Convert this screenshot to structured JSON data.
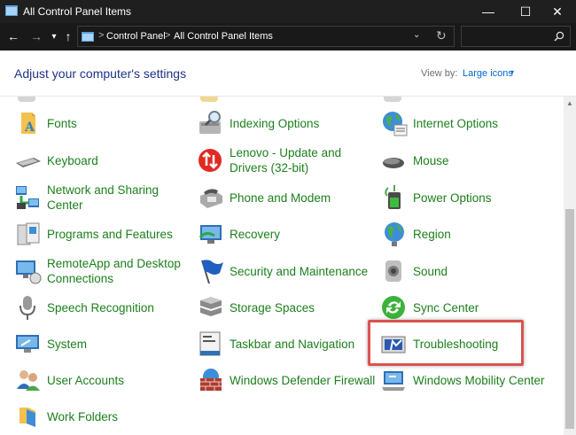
{
  "window": {
    "title": "All Control Panel Items",
    "minimize": "—",
    "maximize": "☐",
    "close": "✕"
  },
  "nav": {
    "back": "←",
    "forward": "→",
    "recent": "▾",
    "up": "↑"
  },
  "address": {
    "crumbs": [
      "Control Panel",
      "All Control Panel Items"
    ],
    "separator": ">",
    "dropdown": "⌄",
    "refresh": "↻"
  },
  "search": {
    "value": "",
    "placeholder": ""
  },
  "header": {
    "heading": "Adjust your computer's settings",
    "view_by_label": "View by:",
    "view_by_value": "Large icons",
    "caret": "▾"
  },
  "items": [
    {
      "label": "Fonts",
      "icon": "fonts-icon"
    },
    {
      "label": "Indexing Options",
      "icon": "indexing-icon"
    },
    {
      "label": "Internet Options",
      "icon": "globe-icon"
    },
    {
      "label": "Keyboard",
      "icon": "keyboard-icon"
    },
    {
      "label": "Lenovo - Update and Drivers (32-bit)",
      "icon": "lenovo-update-icon"
    },
    {
      "label": "Mouse",
      "icon": "mouse-icon"
    },
    {
      "label": "Network and Sharing Center",
      "icon": "network-icon"
    },
    {
      "label": "Phone and Modem",
      "icon": "phone-icon"
    },
    {
      "label": "Power Options",
      "icon": "power-icon"
    },
    {
      "label": "Programs and Features",
      "icon": "programs-icon"
    },
    {
      "label": "Recovery",
      "icon": "recovery-icon"
    },
    {
      "label": "Region",
      "icon": "region-globe-icon"
    },
    {
      "label": "RemoteApp and Desktop Connections",
      "icon": "remoteapp-icon"
    },
    {
      "label": "Security and Maintenance",
      "icon": "flag-icon"
    },
    {
      "label": "Sound",
      "icon": "speaker-icon"
    },
    {
      "label": "Speech Recognition",
      "icon": "microphone-icon"
    },
    {
      "label": "Storage Spaces",
      "icon": "storage-icon"
    },
    {
      "label": "Sync Center",
      "icon": "sync-icon"
    },
    {
      "label": "System",
      "icon": "system-icon"
    },
    {
      "label": "Taskbar and Navigation",
      "icon": "taskbar-icon"
    },
    {
      "label": "Troubleshooting",
      "icon": "troubleshooting-icon"
    },
    {
      "label": "User Accounts",
      "icon": "users-icon"
    },
    {
      "label": "Windows Defender Firewall",
      "icon": "firewall-icon"
    },
    {
      "label": "Windows Mobility Center",
      "icon": "mobility-icon"
    },
    {
      "label": "Work Folders",
      "icon": "work-folders-icon"
    }
  ],
  "colors": {
    "link_green": "#1c7f1c",
    "heading_blue": "#1e3287",
    "highlight_red": "#d9534f",
    "titlebar": "#1f1f1f"
  }
}
